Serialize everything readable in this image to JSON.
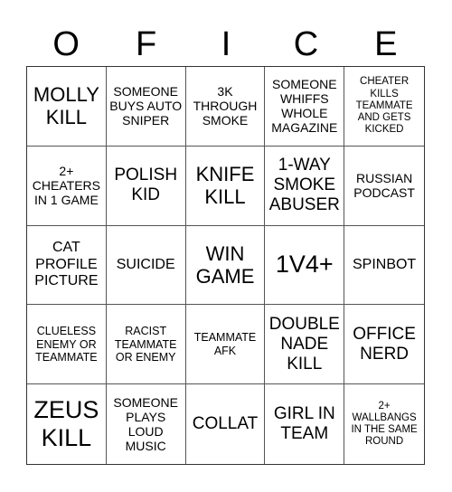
{
  "header": {
    "letters": [
      "O",
      "F",
      "I",
      "C",
      "E"
    ]
  },
  "cells": [
    {
      "text": "MOLLY KILL",
      "size": "s-lg"
    },
    {
      "text": "SOMEONE BUYS AUTO SNIPER",
      "size": "s-xs"
    },
    {
      "text": "3K THROUGH SMOKE",
      "size": "s-xs"
    },
    {
      "text": "SOMEONE WHIFFS WHOLE MAGAZINE",
      "size": "s-xs"
    },
    {
      "text": "CHEATER KILLS TEAMMATE AND GETS KICKED",
      "size": "s-tiny"
    },
    {
      "text": "2+ CHEATERS IN 1 GAME",
      "size": "s-xs"
    },
    {
      "text": "POLISH KID",
      "size": "s-md"
    },
    {
      "text": "KNIFE KILL",
      "size": "s-lg"
    },
    {
      "text": "1-WAY SMOKE ABUSER",
      "size": "s-md"
    },
    {
      "text": "RUSSIAN PODCAST",
      "size": "s-xs"
    },
    {
      "text": "CAT PROFILE PICTURE",
      "size": "s-sm"
    },
    {
      "text": "SUICIDE",
      "size": "s-sm"
    },
    {
      "text": "WIN GAME",
      "size": "s-lg"
    },
    {
      "text": "1V4+",
      "size": "s-xl"
    },
    {
      "text": "SPINBOT",
      "size": "s-sm"
    },
    {
      "text": "CLUELESS ENEMY OR TEAMMATE",
      "size": "s-xxs"
    },
    {
      "text": "RACIST TEAMMATE OR ENEMY",
      "size": "s-xxs"
    },
    {
      "text": "TEAMMATE AFK",
      "size": "s-xxs"
    },
    {
      "text": "DOUBLE NADE KILL",
      "size": "s-md"
    },
    {
      "text": "OFFICE NERD",
      "size": "s-md"
    },
    {
      "text": "ZEUS KILL",
      "size": "s-xl"
    },
    {
      "text": "SOMEONE PLAYS LOUD MUSIC",
      "size": "s-xs"
    },
    {
      "text": "COLLAT",
      "size": "s-md"
    },
    {
      "text": "GIRL IN TEAM",
      "size": "s-md"
    },
    {
      "text": "2+ WALLBANGS IN THE SAME ROUND",
      "size": "s-tiny"
    }
  ]
}
